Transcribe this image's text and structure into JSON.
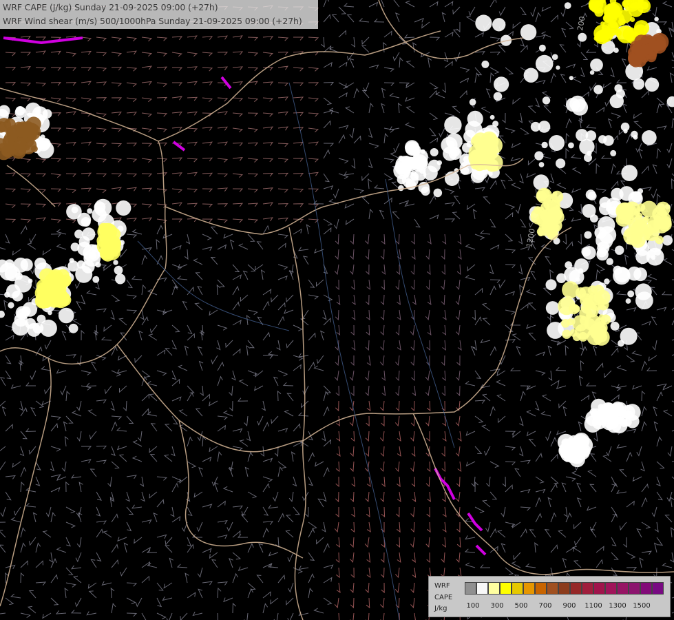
{
  "title": {
    "line1": "WRF CAPE (J/kg) Sunday 21-09-2025 09:00 (+27h)",
    "line2": "WRF Wind shear (m/s) 500/1000hPa Sunday 21-09-2025 09:00 (+27h)"
  },
  "map": {
    "background": "#000000",
    "border_color": "#d8b898",
    "contour_labels": [
      "200",
      "1200"
    ]
  },
  "legend": {
    "label_line1": "WRF",
    "label_line2": "CAPE",
    "label_line3": "J/kg",
    "swatch_colors": [
      "#909090",
      "#f8f8f8",
      "#ffffa0",
      "#ffff00",
      "#e6c800",
      "#e69600",
      "#c86400",
      "#a05020",
      "#8c3c1c",
      "#962828",
      "#a01e3c",
      "#a0144b",
      "#a0145a",
      "#961464",
      "#8c146e",
      "#820a78",
      "#780a82"
    ],
    "tick_labels": [
      "100",
      "300",
      "500",
      "700",
      "900",
      "1100",
      "1300",
      "1500"
    ]
  }
}
